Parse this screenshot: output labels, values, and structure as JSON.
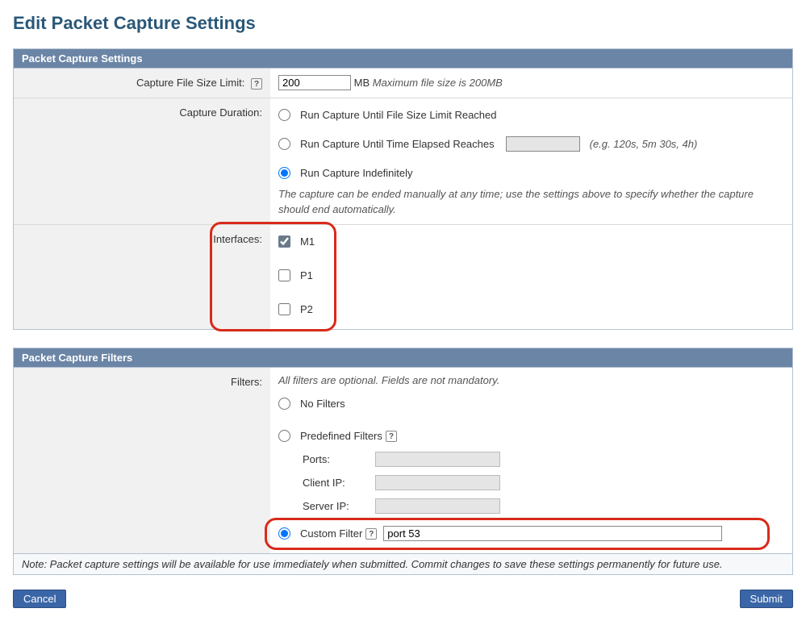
{
  "page": {
    "title": "Edit Packet Capture Settings"
  },
  "settings_panel": {
    "header": "Packet Capture Settings",
    "file_limit_label": "Capture File Size Limit:",
    "file_limit_value": "200",
    "file_limit_unit": "MB",
    "file_limit_hint": "Maximum file size is 200MB",
    "duration_label": "Capture Duration:",
    "duration_opts": {
      "until_size": "Run Capture Until File Size Limit Reached",
      "until_time": "Run Capture Until Time Elapsed Reaches",
      "time_hint": "(e.g. 120s, 5m 30s, 4h)",
      "indef": "Run Capture Indefinitely",
      "note": "The capture can be ended manually at any time; use the settings above to specify whether the capture should end automatically."
    },
    "interfaces_label": "Interfaces:",
    "interfaces": {
      "m1": "M1",
      "p1": "P1",
      "p2": "P2"
    }
  },
  "filters_panel": {
    "header": "Packet Capture Filters",
    "filters_label": "Filters:",
    "filters_hint": "All filters are optional. Fields are not mandatory.",
    "no_filters": "No Filters",
    "predefined": "Predefined Filters",
    "ports_label": "Ports:",
    "client_ip_label": "Client IP:",
    "server_ip_label": "Server IP:",
    "custom": "Custom Filter",
    "custom_value": "port 53"
  },
  "footer_note": "Note: Packet capture settings will be available for use immediately when submitted. Commit changes to save these settings permanently for future use.",
  "buttons": {
    "cancel": "Cancel",
    "submit": "Submit"
  }
}
